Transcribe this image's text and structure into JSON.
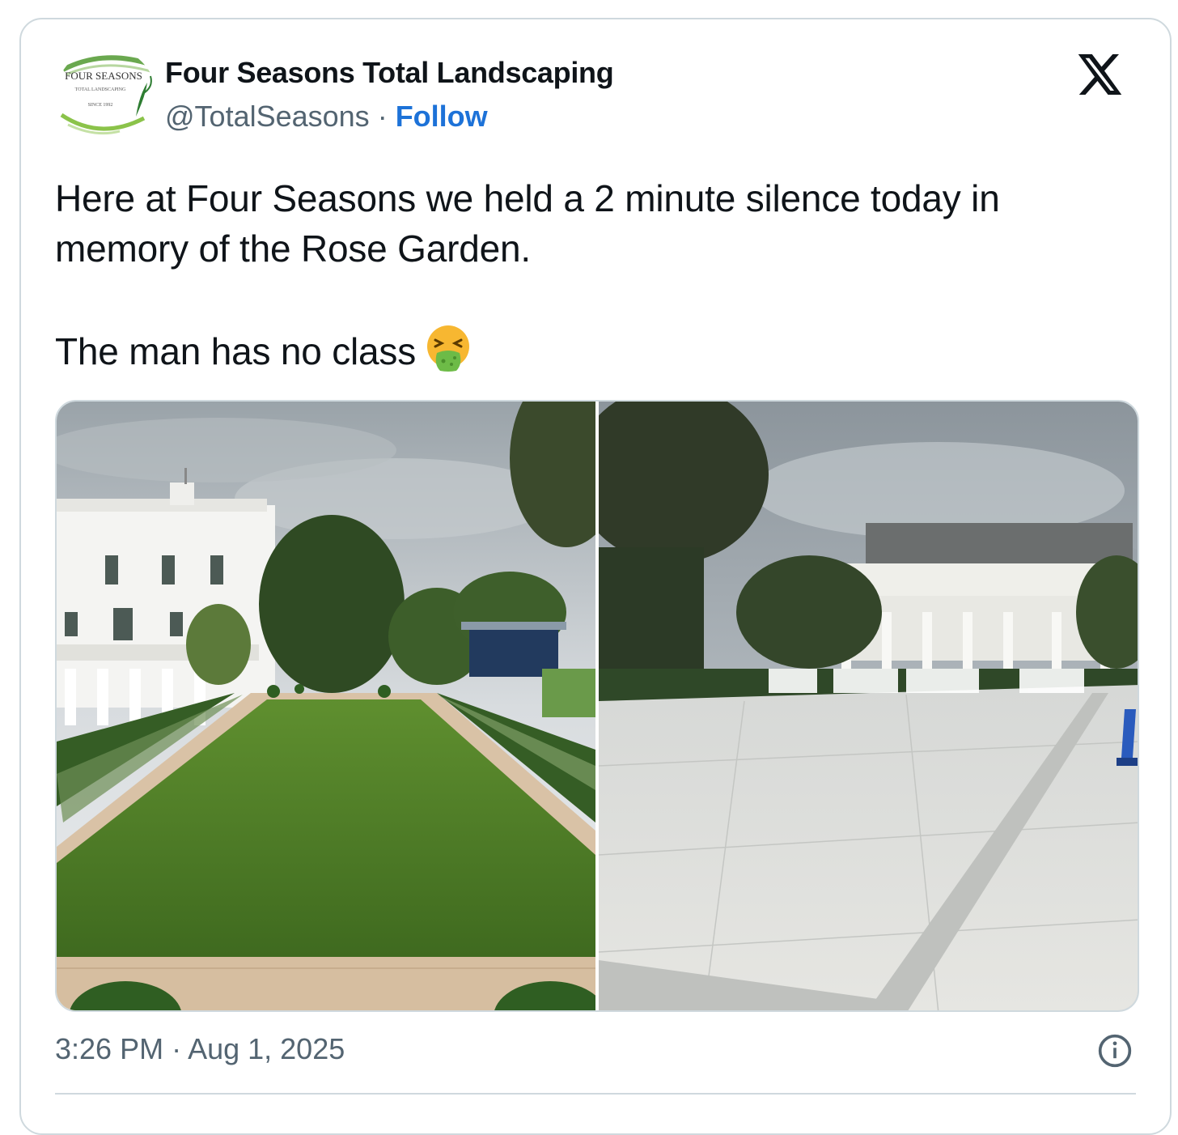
{
  "tweet": {
    "author": {
      "display_name": "Four Seasons Total Landscaping",
      "handle": "@TotalSeasons",
      "separator": " · ",
      "follow_label": "Follow",
      "avatar_text": {
        "line1": "FOUR SEASONS",
        "line2": "TOTAL LANDSCAPING",
        "line3": "SINCE 1992"
      }
    },
    "text_line1": "Here at Four Seasons we held a 2 minute silence today in memory of the Rose Garden.",
    "text_line2": "The man has no class",
    "emoji_icon": "vomiting-face-icon",
    "media": [
      {
        "name": "rose-garden-lawn-photo"
      },
      {
        "name": "rose-garden-paved-photo"
      }
    ],
    "timestamp": "3:26 PM · Aug 1, 2025",
    "platform_logo": "x-logo-icon",
    "info_icon": "info-icon"
  },
  "colors": {
    "text": "#0f1419",
    "secondary": "#536471",
    "link": "#1d72d8",
    "border": "#cfd9de"
  }
}
